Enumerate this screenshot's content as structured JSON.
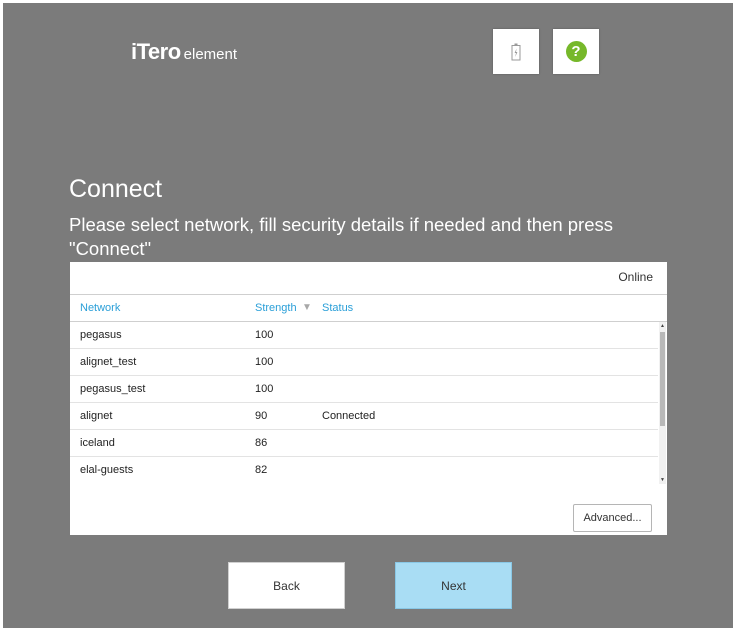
{
  "logo": {
    "brand": "iTero",
    "product": "element"
  },
  "header_buttons": {
    "battery_icon": "battery-icon",
    "help_icon": "help-icon",
    "help_glyph": "?"
  },
  "colors": {
    "background": "#7b7b7b",
    "accent_blue": "#2a9fd8",
    "help_green": "#76b82a",
    "next_button": "#a9ddf4"
  },
  "page": {
    "title": "Connect",
    "subtitle": "Please select network, fill security details if needed and then press \"Connect\""
  },
  "panel": {
    "status": "Online",
    "columns": {
      "network": "Network",
      "strength": "Strength",
      "status": "Status"
    },
    "networks": [
      {
        "name": "pegasus",
        "strength": "100",
        "status": ""
      },
      {
        "name": "alignet_test",
        "strength": "100",
        "status": ""
      },
      {
        "name": "pegasus_test",
        "strength": "100",
        "status": ""
      },
      {
        "name": "alignet",
        "strength": "90",
        "status": "Connected"
      },
      {
        "name": "iceland",
        "strength": "86",
        "status": ""
      },
      {
        "name": "elal-guests",
        "strength": "82",
        "status": ""
      }
    ],
    "advanced_label": "Advanced..."
  },
  "footer": {
    "back_label": "Back",
    "next_label": "Next"
  }
}
